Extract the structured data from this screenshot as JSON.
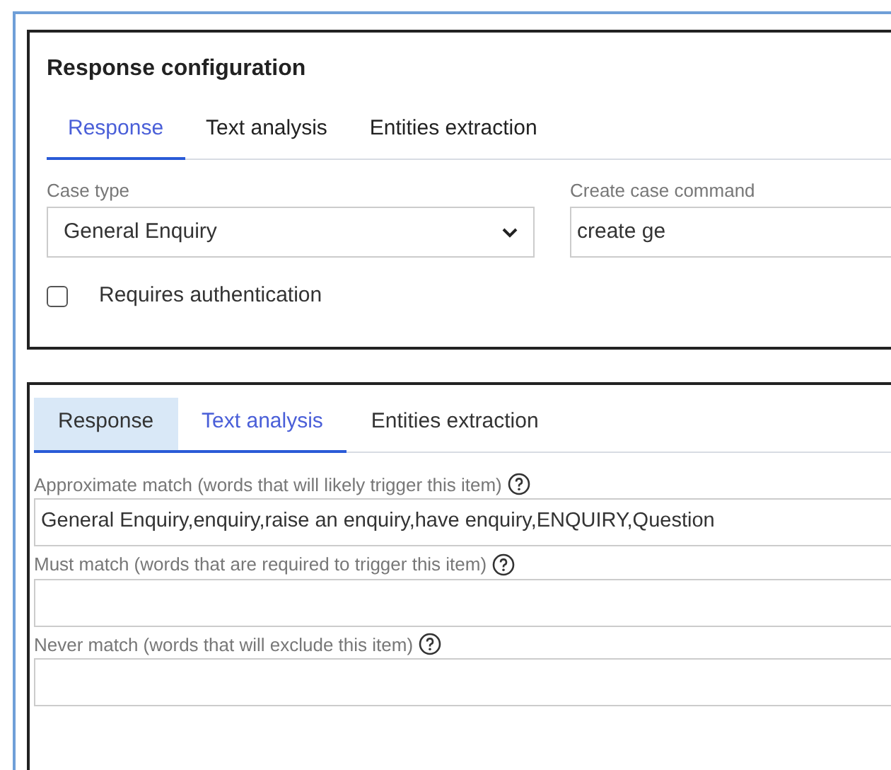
{
  "config_panel": {
    "title": "Response configuration",
    "tabs": [
      {
        "label": "Response",
        "selected": true
      },
      {
        "label": "Text analysis",
        "selected": false
      },
      {
        "label": "Entities extraction",
        "selected": false
      }
    ],
    "case_type": {
      "label": "Case type",
      "value": "General Enquiry"
    },
    "create_case_command": {
      "label": "Create case command",
      "value": "create ge"
    },
    "requires_authentication": {
      "label": "Requires authentication",
      "checked": false
    }
  },
  "text_analysis_panel": {
    "tabs": [
      {
        "label": "Response",
        "selected": false,
        "highlighted": true
      },
      {
        "label": "Text analysis",
        "selected": true,
        "highlighted": false
      },
      {
        "label": "Entities extraction",
        "selected": false,
        "highlighted": false
      }
    ],
    "fields": [
      {
        "label": "Approximate match (words that will likely trigger this item)",
        "value": "General Enquiry,enquiry,raise an enquiry,have enquiry,ENQUIRY,Question"
      },
      {
        "label": "Must match (words that are required to trigger this item)"
      },
      {
        "label": "Never match (words that will exclude this item)"
      }
    ]
  }
}
